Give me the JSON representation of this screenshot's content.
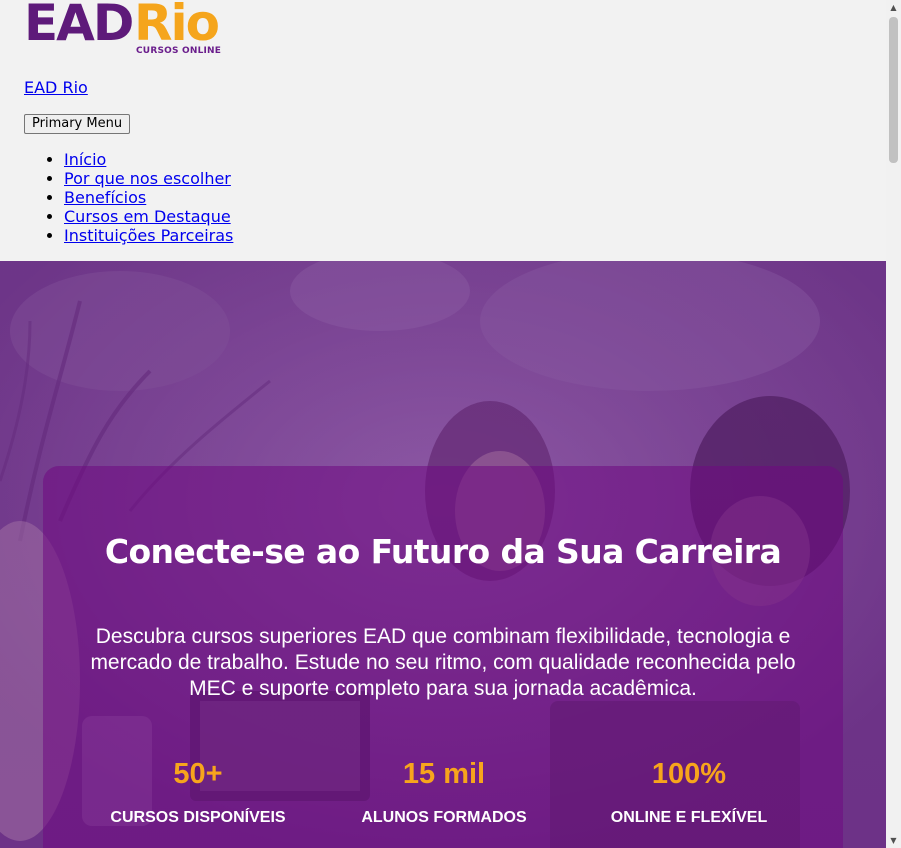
{
  "header": {
    "logo": {
      "ead": "EAD",
      "rio": "Rio",
      "subtitle": "CURSOS ONLINE"
    },
    "site_title": "EAD Rio",
    "menu_toggle_label": "Primary Menu",
    "menu": [
      {
        "label": "Início"
      },
      {
        "label": "Por que nos escolher"
      },
      {
        "label": "Benefícios"
      },
      {
        "label": "Cursos em Destaque"
      },
      {
        "label": "Instituições Parceiras"
      }
    ]
  },
  "hero": {
    "title": "Conecte-se ao Futuro da Sua Carreira",
    "description": "Descubra cursos superiores EAD que combinam flexibilidade, tecnologia e mercado de trabalho. Estude no seu ritmo, com qualidade reconhecida pelo MEC e suporte completo para sua jornada acadêmica.",
    "stats": [
      {
        "value": "50+",
        "label": "CURSOS DISPONÍVEIS"
      },
      {
        "value": "15 mil",
        "label": "ALUNOS FORMADOS"
      },
      {
        "value": "100%",
        "label": "ONLINE E FLEXÍVEL"
      }
    ]
  },
  "colors": {
    "brand_purple": "#5e1a7a",
    "brand_orange": "#f5a51c",
    "link": "#0000ee",
    "stat_value": "#f7a51c"
  },
  "icons": {
    "scroll_up": "arrow-up-icon",
    "scroll_down": "arrow-down-icon"
  }
}
